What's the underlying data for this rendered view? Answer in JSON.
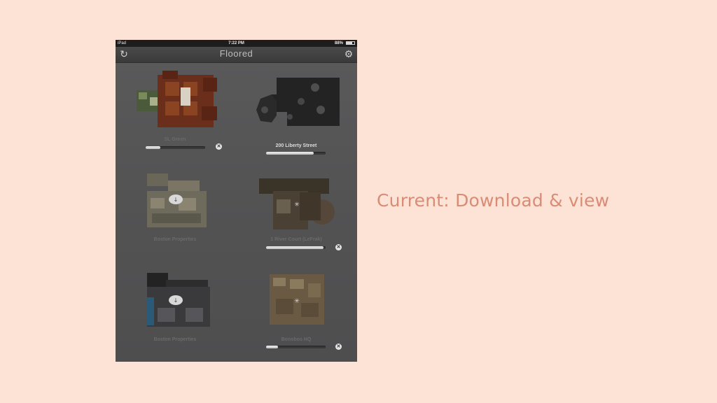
{
  "statusbar": {
    "carrier": "iPad",
    "time": "7:22 PM",
    "battery": "88%"
  },
  "navbar": {
    "title": "Floored",
    "refresh_icon": "refresh-icon",
    "settings_icon": "gear-icon"
  },
  "cards": [
    {
      "name": "SL Green",
      "subtitle": "",
      "state": "downloading",
      "progress": 0.25
    },
    {
      "name": "200 Liberty Street",
      "subtitle": "",
      "state": "downloading",
      "progress": 0.8
    },
    {
      "name": "Boston Properties",
      "subtitle": "",
      "state": "cloud-download",
      "progress": null
    },
    {
      "name": "1 River Court (LeFrak)",
      "subtitle": "",
      "state": "downloading",
      "progress": 0.97
    },
    {
      "name": "Boston Properties",
      "subtitle": "",
      "state": "cloud-download",
      "progress": null
    },
    {
      "name": "Bonobos HQ",
      "subtitle": "",
      "state": "downloading",
      "progress": 0.2
    }
  ],
  "caption": "Current: Download & view",
  "colors": {
    "background": "#fde2d6",
    "caption": "#d98c75",
    "device": "#555556"
  }
}
